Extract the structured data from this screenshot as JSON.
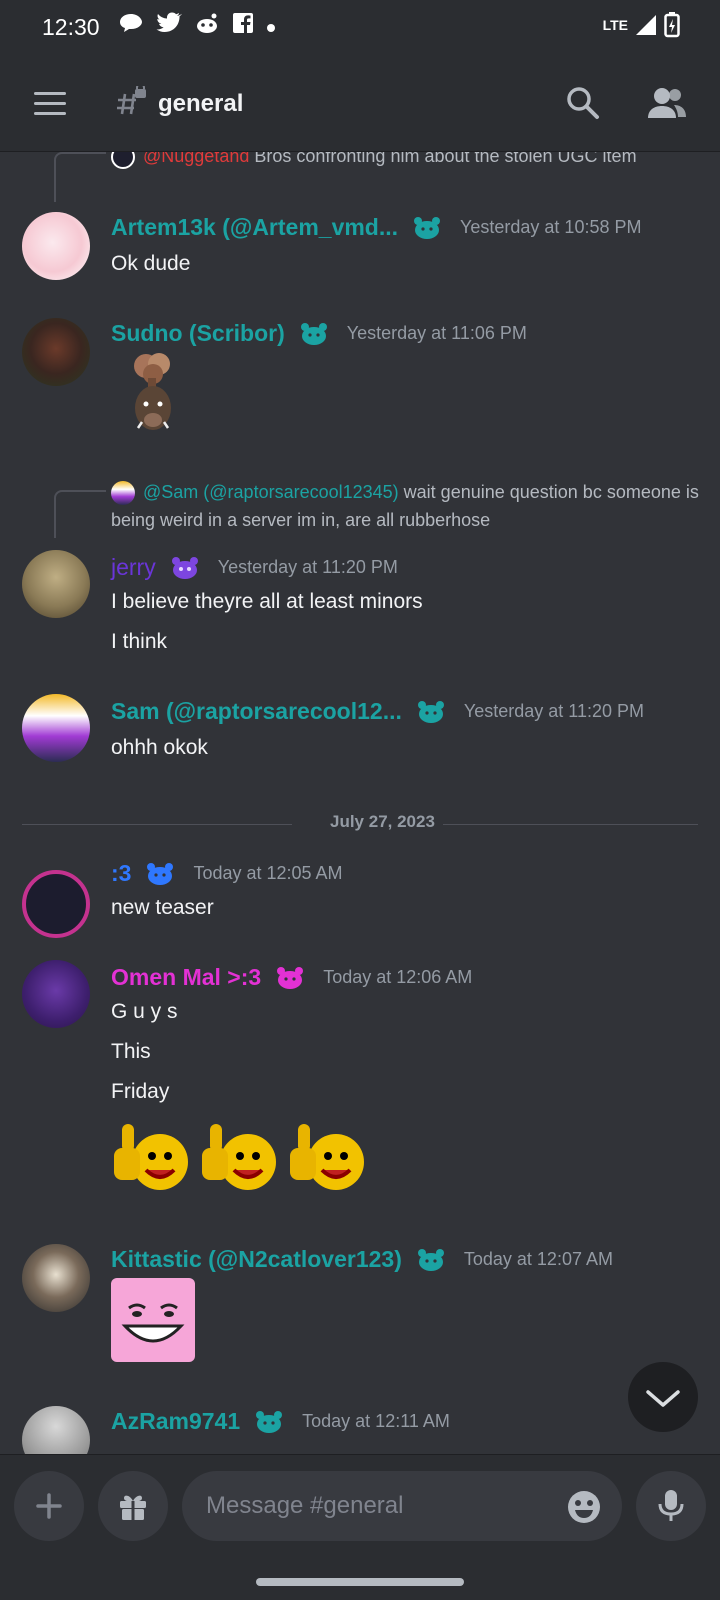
{
  "status_bar": {
    "time": "12:30",
    "network": "LTE"
  },
  "header": {
    "channel_name": "general"
  },
  "messages": {
    "reply1": {
      "mention": "@Nuggetand",
      "text": "Bros confronting him about the stolen UGC item"
    },
    "m1": {
      "user": "Artem13k (@Artem_vmd...",
      "time": "Yesterday at 10:58 PM",
      "text": "Ok dude"
    },
    "m2": {
      "user": "Sudno (Scribor)",
      "time": "Yesterday at 11:06 PM"
    },
    "reply2": {
      "mention": "@Sam (@raptorsarecool12345)",
      "text": "wait genuine question bc someone is being weird in a server im in, are all rubberhose"
    },
    "m3": {
      "user": "jerry",
      "time": "Yesterday at 11:20 PM",
      "line1": "I believe theyre all at least minors",
      "line2": "I think"
    },
    "m4": {
      "user": "Sam (@raptorsarecool12...",
      "time": "Yesterday at 11:20 PM",
      "text": "ohhh okok"
    },
    "divider": "July 27, 2023",
    "m5": {
      "user": ":3",
      "time": "Today at 12:05 AM",
      "text": "new teaser"
    },
    "m6": {
      "user": "Omen Mal >:3",
      "time": "Today at 12:06 AM",
      "line1": "G u y s",
      "line2": "This",
      "line3": "Friday"
    },
    "m7": {
      "user": "Kittastic (@N2catlover123)",
      "time": "Today at 12:07 AM"
    },
    "m8": {
      "user": "AzRam9741",
      "time": "Today at 12:11 AM"
    }
  },
  "composer": {
    "placeholder": "Message #general"
  },
  "colors": {
    "teal": "#1ba3a3",
    "purple": "#6a35d8",
    "blue": "#2f78ff",
    "magenta": "#e331d4",
    "mention_red": "#e03a3a",
    "background": "#313338"
  }
}
